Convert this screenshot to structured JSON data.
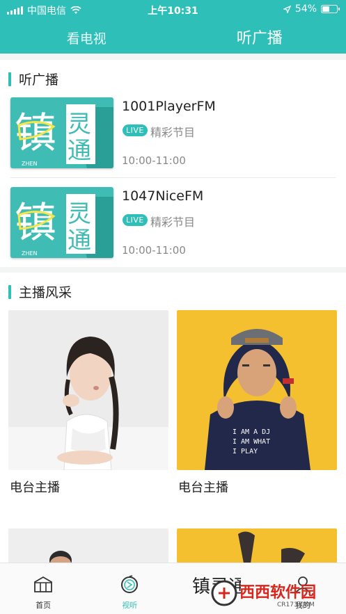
{
  "status_bar": {
    "carrier": "中国电信",
    "time": "上午10:31",
    "battery": "54%",
    "battery_level": 0.54
  },
  "tabs": [
    {
      "label": "看电视",
      "active": false
    },
    {
      "label": "听广播",
      "active": true
    }
  ],
  "radio_section": {
    "title": "听广播",
    "items": [
      {
        "name": "1001PlayerFM",
        "badge": "LIVE",
        "desc": "精彩节目",
        "time": "10:00-11:00",
        "cover_text": "镇灵通",
        "cover_sub": "ZHEN"
      },
      {
        "name": "1047NiceFM",
        "badge": "LIVE",
        "desc": "精彩节目",
        "time": "10:00-11:00",
        "cover_text": "镇灵通",
        "cover_sub": "ZHEN"
      }
    ]
  },
  "hosts_section": {
    "title": "主播风采",
    "hosts": [
      {
        "label": "电台主播"
      },
      {
        "label": "电台主播"
      }
    ],
    "shirt_text": [
      "I AM A DJ",
      "I AM WHAT",
      "I PLAY"
    ]
  },
  "bottom_nav": [
    {
      "label": "首页",
      "icon": "home-icon",
      "active": false
    },
    {
      "label": "视听",
      "icon": "play-circle-icon",
      "active": true
    },
    {
      "label": "镇灵通",
      "icon": "brand-logo-icon",
      "active": false
    },
    {
      "label": "我的",
      "icon": "user-icon",
      "active": false
    }
  ],
  "watermark": {
    "text": "西西软件园",
    "url": "CR173.COM"
  },
  "colors": {
    "accent": "#2fbfb9",
    "host_bg_2": "#f4c02f"
  }
}
